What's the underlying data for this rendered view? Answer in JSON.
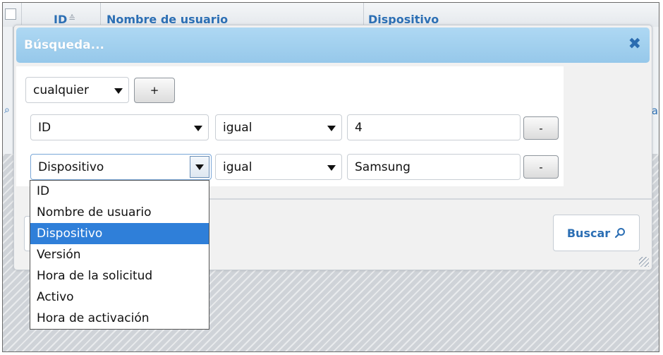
{
  "grid": {
    "columns": [
      "ID",
      "Nombre de usuario",
      "Dispositivo"
    ],
    "sort_icon": "sort-asc-icon",
    "right_edge_letter": "a"
  },
  "dialog": {
    "title": "Búsqueda...",
    "close_icon": "close-icon",
    "match_select": {
      "value": "cualquier"
    },
    "add_button": "+",
    "rows": [
      {
        "field": "ID",
        "operator": "igual",
        "value": "4",
        "remove_label": "-"
      },
      {
        "field": "Dispositivo",
        "operator": "igual",
        "value": "Samsung",
        "remove_label": "-"
      }
    ],
    "search_button": {
      "label": "Buscar",
      "icon": "search-icon"
    }
  },
  "dropdown": {
    "options": [
      "ID",
      "Nombre de usuario",
      "Dispositivo",
      "Versión",
      "Hora de la solicitud",
      "Activo",
      "Hora de activación"
    ],
    "selected": "Dispositivo"
  },
  "colors": {
    "title_bar": "#a6d1f0",
    "accent_blue": "#2c6fb4",
    "selected_option": "#2f7fd9"
  }
}
